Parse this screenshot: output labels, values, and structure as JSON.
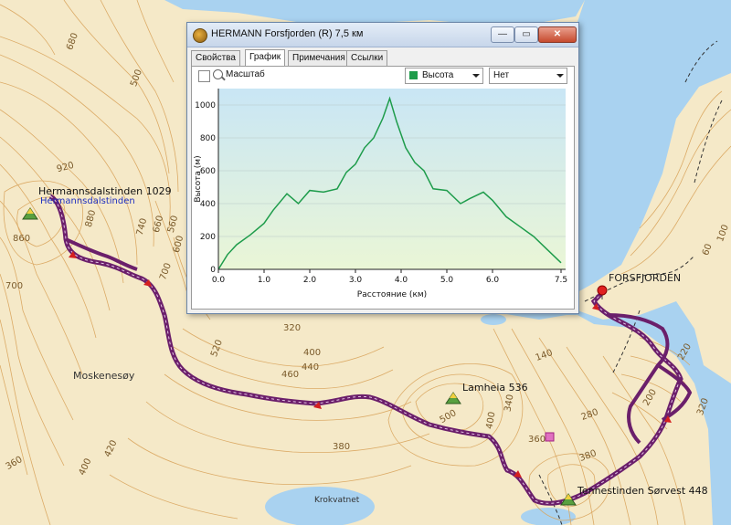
{
  "window": {
    "title": "HERMANN Forsfjorden (R) 7,5 км",
    "buttons": {
      "minimize": "—",
      "maximize": "▭",
      "close": "✕"
    },
    "tabs": [
      {
        "label": "Свойства",
        "active": false
      },
      {
        "label": "График",
        "active": true
      },
      {
        "label": "Примечания",
        "active": false
      },
      {
        "label": "Ссылки",
        "active": false
      }
    ],
    "toolbar": {
      "scale_label": "Масштаб",
      "series_select": "Высота",
      "compare_select": "Нет"
    }
  },
  "chart_data": {
    "type": "area",
    "ylabel": "Высота (м)",
    "xlabel": "Расстояние   (км)",
    "xlim": [
      0,
      7.6
    ],
    "ylim": [
      0,
      1100
    ],
    "xticks": [
      "0.0",
      "1.0",
      "2.0",
      "3.0",
      "4.0",
      "5.0",
      "6.0",
      "7.5"
    ],
    "xtick_values": [
      0,
      1,
      2,
      3,
      4,
      5,
      6,
      7.5
    ],
    "yticks": [
      "0",
      "200",
      "400",
      "600",
      "800",
      "1000"
    ],
    "ytick_values": [
      0,
      200,
      400,
      600,
      800,
      1000
    ],
    "grid": true,
    "color": "#1e9c4b",
    "series": [
      {
        "name": "Высота",
        "x": [
          0,
          0.2,
          0.4,
          0.7,
          1.0,
          1.2,
          1.5,
          1.75,
          2.0,
          2.3,
          2.6,
          2.8,
          3.0,
          3.2,
          3.4,
          3.6,
          3.75,
          3.9,
          4.1,
          4.3,
          4.5,
          4.7,
          5.0,
          5.3,
          5.5,
          5.8,
          6.0,
          6.3,
          6.6,
          6.9,
          7.2,
          7.5
        ],
        "y": [
          0,
          90,
          150,
          210,
          280,
          360,
          460,
          400,
          480,
          470,
          490,
          590,
          640,
          740,
          800,
          920,
          1040,
          900,
          740,
          650,
          600,
          490,
          480,
          400,
          430,
          470,
          420,
          320,
          260,
          200,
          120,
          40
        ]
      }
    ]
  },
  "map": {
    "peaks": [
      {
        "name": "Hermannsdalstinden 1029",
        "sub": "Hermannsdalstinden"
      },
      {
        "name": "Lamheia 536"
      },
      {
        "name": "Tennestinden Sørvest 448"
      }
    ],
    "waypoint": "FORSFJORDEN",
    "place_labels": [
      "Moskenesøy",
      "Krokvatnet"
    ],
    "contour_labels": [
      "680",
      "500",
      "920",
      "880",
      "860",
      "740",
      "660",
      "560",
      "700",
      "600",
      "700",
      "520",
      "460",
      "440",
      "400",
      "320",
      "380",
      "420",
      "400",
      "360",
      "500",
      "400",
      "340",
      "360",
      "380",
      "140",
      "280",
      "200",
      "220",
      "60",
      "100",
      "320"
    ],
    "colors": {
      "water": "#a9d2f0",
      "land": "#f5e9c8",
      "contour": "#d9a45c",
      "track": "#6b1f6b"
    }
  }
}
